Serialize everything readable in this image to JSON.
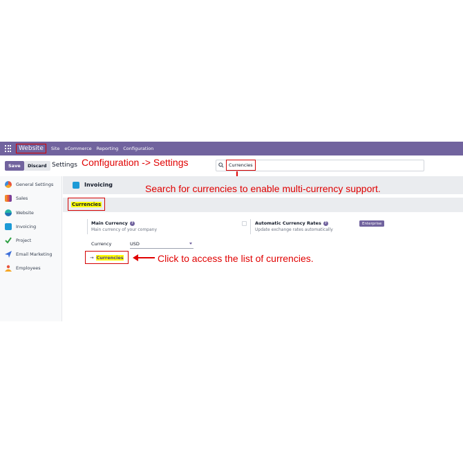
{
  "navbar": {
    "brand": "Website",
    "items": [
      "Site",
      "eCommerce",
      "Reporting",
      "Configuration"
    ]
  },
  "control": {
    "save_label": "Save",
    "discard_label": "Discard",
    "breadcrumb": "Settings",
    "search_value": "Currencies"
  },
  "sidebar": {
    "items": [
      {
        "label": "General Settings",
        "icon": "gear-icon"
      },
      {
        "label": "Sales",
        "icon": "sales-chart-icon"
      },
      {
        "label": "Website",
        "icon": "globe-icon"
      },
      {
        "label": "Invoicing",
        "icon": "invoice-icon"
      },
      {
        "label": "Project",
        "icon": "check-icon"
      },
      {
        "label": "Email Marketing",
        "icon": "paper-plane-icon"
      },
      {
        "label": "Employees",
        "icon": "people-icon"
      }
    ]
  },
  "main": {
    "section_title": "Invoicing",
    "subsection": "Currencies",
    "main_currency": {
      "title": "Main Currency",
      "desc": "Main currency of your company",
      "field_label": "Currency",
      "field_value": "USD",
      "link_arrow": "→",
      "link_label": "Currencies"
    },
    "auto_rates": {
      "title": "Automatic Currency Rates",
      "desc": "Update exchange rates automatically",
      "badge": "Enterprise"
    }
  },
  "annotations": {
    "config": "Configuration -> Settings",
    "search": "Search for currencies to enable multi-currency support.",
    "click": "Click to access the list of currencies."
  },
  "colors": {
    "brand": "#71639e",
    "annotation": "#e00000",
    "highlight": "#ffff00"
  }
}
